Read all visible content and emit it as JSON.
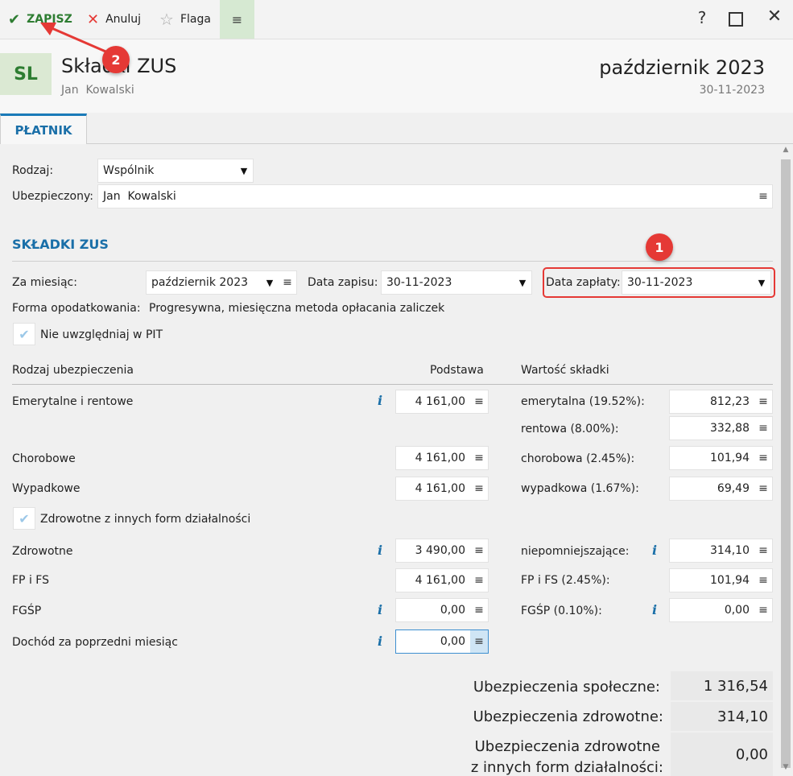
{
  "toolbar": {
    "save_label": "ZAPISZ",
    "cancel_label": "Anuluj",
    "flag_label": "Flaga",
    "menu_icon": "hamburger-icon",
    "help_label": "?",
    "colors": {
      "save": "#2e7d32",
      "cancel": "#e53935"
    }
  },
  "header": {
    "logo": "SL",
    "title": "Składki ZUS",
    "subtitle": "Jan  Kowalski",
    "period": "październik 2023",
    "date": "30-11-2023"
  },
  "tabs": [
    {
      "label": "PŁATNIK",
      "active": true
    }
  ],
  "platnik": {
    "rodzaj_label": "Rodzaj:",
    "rodzaj_value": "Wspólnik",
    "ubezpieczony_label": "Ubezpieczony:",
    "ubezpieczony_value": "Jan  Kowalski"
  },
  "skladki": {
    "section_title": "SKŁADKI ZUS",
    "za_miesiac_label": "Za miesiąc:",
    "za_miesiac_value": "październik 2023",
    "data_zapisu_label": "Data zapisu:",
    "data_zapisu_value": "30-11-2023",
    "data_zaplaty_label": "Data zapłaty:",
    "data_zaplaty_value": "30-11-2023",
    "forma_label": "Forma opodatkowania:",
    "forma_value": "Progresywna, miesięczna metoda opłacania zaliczek",
    "nie_pit_label": "Nie uwzględniaj w PIT",
    "col_rodzaj": "Rodzaj ubezpieczenia",
    "col_podstawa": "Podstawa",
    "col_wartosc": "Wartość składki",
    "emerytalne_label": "Emerytalne i rentowe",
    "emerytalne_podstawa": "4 161,00",
    "emerytalna_label": "emerytalna (19.52%):",
    "emerytalna_value": "812,23",
    "rentowa_label": "rentowa (8.00%):",
    "rentowa_value": "332,88",
    "chorobowe_label": "Chorobowe",
    "chorobowe_podstawa": "4 161,00",
    "chorobowa_label": "chorobowa (2.45%):",
    "chorobowa_value": "101,94",
    "wypadkowe_label": "Wypadkowe",
    "wypadkowe_podstawa": "4 161,00",
    "wypadkowa_label": "wypadkowa (1.67%):",
    "wypadkowa_value": "69,49",
    "zdrowotne_inne_label": "Zdrowotne z innych form działalności",
    "zdrowotne_label": "Zdrowotne",
    "zdrowotne_podstawa": "3 490,00",
    "niepomniejszajace_label": "niepomniejszające:",
    "niepomniejszajace_value": "314,10",
    "fp_label": "FP i FS",
    "fp_podstawa": "4 161,00",
    "fp_skladka_label": "FP i FS (2.45%):",
    "fp_skladka_value": "101,94",
    "fgsp_label": "FGŚP",
    "fgsp_podstawa": "0,00",
    "fgsp_skladka_label": "FGŚP (0.10%):",
    "fgsp_skladka_value": "0,00",
    "dochod_label": "Dochód za poprzedni miesiąc",
    "dochod_value": "0,00"
  },
  "summary": {
    "spoleczne_label": "Ubezpieczenia społeczne:",
    "spoleczne_value": "1 316,54",
    "zdrowotne_label": "Ubezpieczenia zdrowotne:",
    "zdrowotne_value": "314,10",
    "zdrowotne_inne_line1": "Ubezpieczenia zdrowotne",
    "zdrowotne_inne_line2": "z innych form działalności:",
    "zdrowotne_inne_value": "0,00"
  },
  "annotations": {
    "badge1": "1",
    "badge2": "2",
    "color": "#e53935"
  }
}
